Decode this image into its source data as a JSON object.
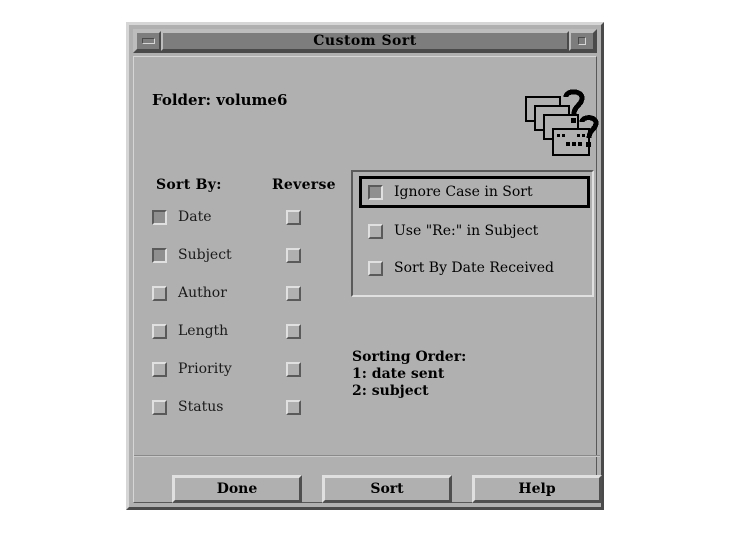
{
  "window": {
    "title": "Custom Sort",
    "minimize_icon": "minimize-icon",
    "maximize_icon": "maximize-icon"
  },
  "header": {
    "folder_label": "Folder: volume6",
    "stack_icon": "message-stack-question-icon"
  },
  "columns": {
    "sort_by_header": "Sort By:",
    "reverse_header": "Reverse"
  },
  "sort_criteria": [
    {
      "label": "Date",
      "selected": true,
      "reverse": false
    },
    {
      "label": "Subject",
      "selected": true,
      "reverse": false
    },
    {
      "label": "Author",
      "selected": false,
      "reverse": false
    },
    {
      "label": "Length",
      "selected": false,
      "reverse": false
    },
    {
      "label": "Priority",
      "selected": false,
      "reverse": false
    },
    {
      "label": "Status",
      "selected": false,
      "reverse": false
    }
  ],
  "options": [
    {
      "label": "Ignore Case in Sort",
      "selected": true,
      "focused": true
    },
    {
      "label": "Use \"Re:\" in Subject",
      "selected": false,
      "focused": false
    },
    {
      "label": "Sort By Date Received",
      "selected": false,
      "focused": false
    }
  ],
  "sorting_order": {
    "title": "Sorting Order:",
    "lines": [
      "1: date sent",
      "2: subject"
    ]
  },
  "buttons": {
    "done": "Done",
    "sort": "Sort",
    "help": "Help"
  },
  "colors": {
    "face": "#b0b0b0",
    "titlebar": "#7d7d7d",
    "shadow": "#4a4a4a",
    "highlight": "#d6d6d6",
    "text": "#000000",
    "focus_border": "#000000"
  }
}
